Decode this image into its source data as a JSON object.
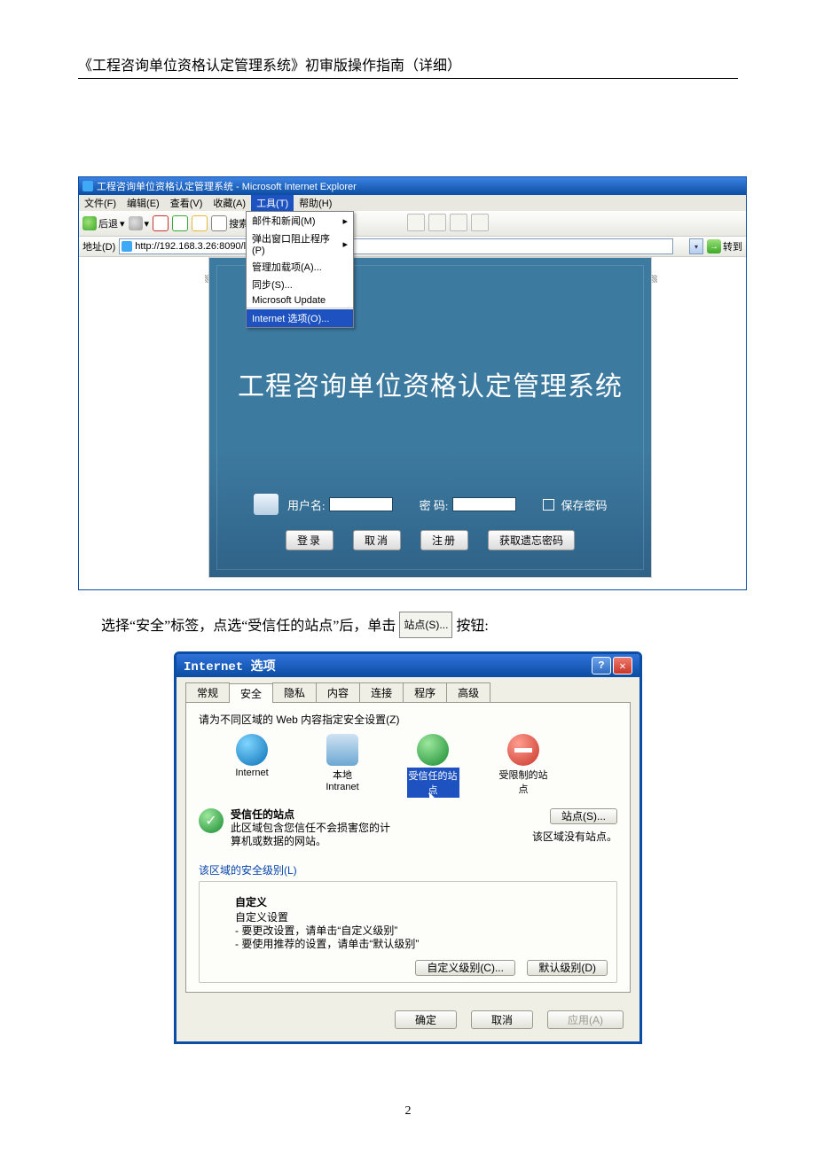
{
  "doc": {
    "header": "《工程咨询单位资格认定管理系统》初审版操作指南（详细）",
    "page_number": "2"
  },
  "ie": {
    "title": "工程咨询单位资格认定管理系统 - Microsoft Internet Explorer",
    "menubar": {
      "file": "文件(F)",
      "edit": "编辑(E)",
      "view": "查看(V)",
      "fav": "收藏(A)",
      "tools": "工具(T)",
      "help": "帮助(H)"
    },
    "toolbar": {
      "back": "后退",
      "search": "搜索"
    },
    "addr": {
      "label": "地址(D)",
      "url": "http://192.168.3.26:8090/lo",
      "go": "转到"
    },
    "tools_menu": {
      "mail": "邮件和新闻(M)",
      "popup": "弹出窗口阻止程序(P)",
      "addons": "管理加载项(A)...",
      "sync": "同步(S)...",
      "update": "Microsoft Update",
      "options": "Internet 选项(O)..."
    },
    "splash": {
      "title": "工程咨询单位资格认定管理系统",
      "user": "用户名:",
      "pass": "密 码:",
      "remember": "保存密码",
      "login": "登录",
      "cancel": "取消",
      "register": "注册",
      "forgot": "获取遗忘密码"
    }
  },
  "instr": {
    "p1": "选择“安全”标签，点选“受信任的站点”后，单击",
    "btn": "站点(S)...",
    "p2": "按钮:"
  },
  "dlg": {
    "title": "Internet 选项",
    "tabs": {
      "general": "常规",
      "security": "安全",
      "privacy": "隐私",
      "content": "内容",
      "conn": "连接",
      "programs": "程序",
      "advanced": "高级"
    },
    "prompt": "请为不同区域的 Web 内容指定安全设置(Z)",
    "zones": {
      "internet": "Internet",
      "local": "本地\nIntranet",
      "trusted": "受信任的站\n点",
      "restricted": "受限制的站\n点"
    },
    "trusted": {
      "heading": "受信任的站点",
      "desc": "此区域包含您信任不会损害您的计\n算机或数据的网站。",
      "sites_btn": "站点(S)...",
      "nosites": "该区域没有站点。"
    },
    "level": {
      "group": "该区域的安全级别(L)",
      "custom_head": "自定义",
      "custom_sub": "自定义设置",
      "line1": "- 要更改设置，请单击“自定义级别”",
      "line2": "- 要使用推荐的设置，请单击“默认级别”",
      "custom_btn": "自定义级别(C)...",
      "default_btn": "默认级别(D)"
    },
    "footer": {
      "ok": "确定",
      "cancel": "取消",
      "apply": "应用(A)"
    }
  }
}
